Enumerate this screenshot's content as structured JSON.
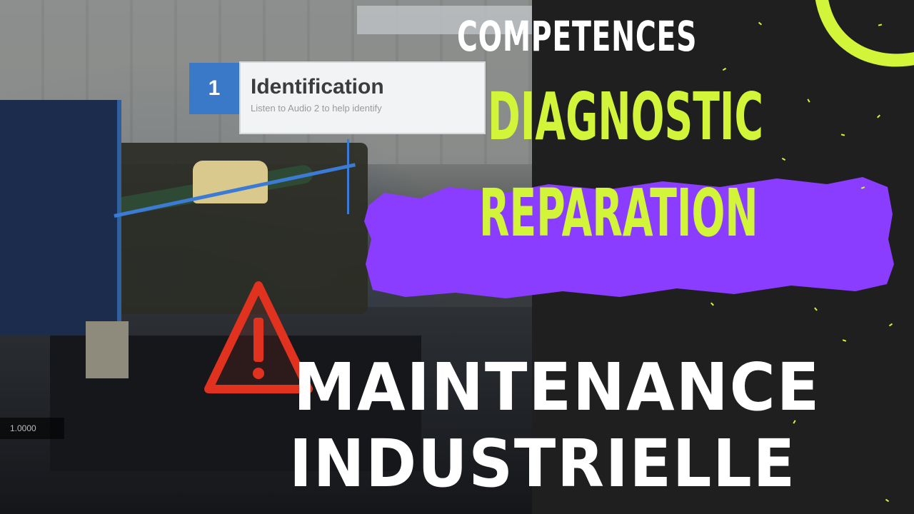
{
  "callout": {
    "number": "1",
    "title": "Identification",
    "subtitle": "Listen to Audio 2 to help identify"
  },
  "photo_overlay_text": "1.0000",
  "headings": {
    "competences": "COMPETENCES",
    "diagnostic": "DIAGNOSTIC",
    "reparation": "REPARATION",
    "maintenance": "MAINTENANCE",
    "industrielle": "INDUSTRIELLE"
  },
  "colors": {
    "accent_lime": "#d2f53a",
    "brush_purple": "#8a3cff",
    "background_dark": "#1f1f1f",
    "callout_blue": "#3a78c8",
    "warning_red": "#e0321e"
  },
  "icons": [
    "warning-triangle-icon",
    "lime-arc-decoration"
  ]
}
